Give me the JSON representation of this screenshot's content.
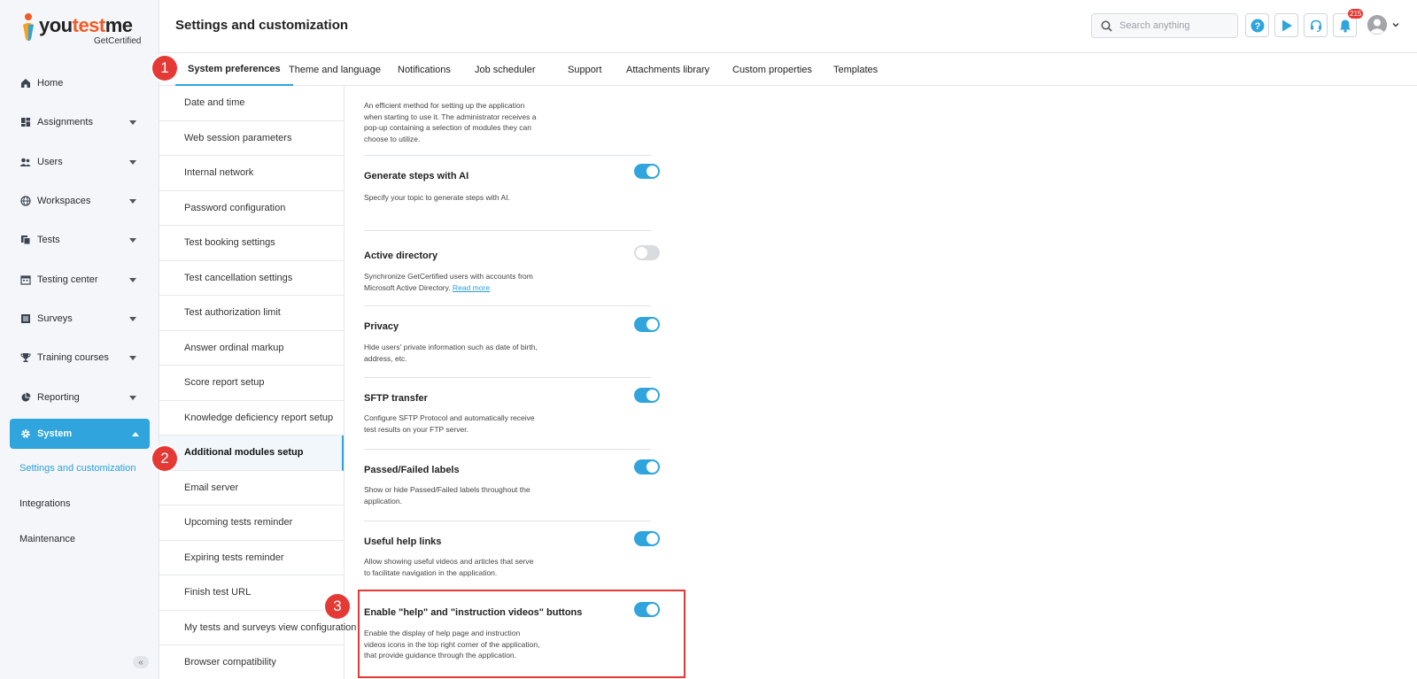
{
  "logo": {
    "brand_prefix": "you",
    "brand_accent": "test",
    "brand_suffix": "me",
    "sub": "GetCertified"
  },
  "sidebar": {
    "items": [
      {
        "label": "Home",
        "icon": "home-icon"
      },
      {
        "label": "Assignments",
        "icon": "dashboard-icon"
      },
      {
        "label": "Users",
        "icon": "users-icon"
      },
      {
        "label": "Workspaces",
        "icon": "globe-icon"
      },
      {
        "label": "Tests",
        "icon": "tests-icon"
      },
      {
        "label": "Testing center",
        "icon": "calendar-icon"
      },
      {
        "label": "Surveys",
        "icon": "list-icon"
      },
      {
        "label": "Training courses",
        "icon": "trophy-icon"
      },
      {
        "label": "Reporting",
        "icon": "chart-pie-icon"
      },
      {
        "label": "System",
        "icon": "gear-icon"
      }
    ],
    "sub_items": [
      {
        "label": "Settings and customization"
      },
      {
        "label": "Integrations"
      },
      {
        "label": "Maintenance"
      }
    ],
    "collapse_glyph": "«"
  },
  "header": {
    "title": "Settings and customization",
    "search_placeholder": "Search anything",
    "notification_count": "215"
  },
  "tabs": [
    {
      "label": "System preferences"
    },
    {
      "label": "Theme and language"
    },
    {
      "label": "Notifications"
    },
    {
      "label": "Job scheduler"
    },
    {
      "label": "Support"
    },
    {
      "label": "Attachments library"
    },
    {
      "label": "Custom properties"
    },
    {
      "label": "Templates"
    }
  ],
  "settings_list": [
    "Date and time",
    "Web session parameters",
    "Internal network",
    "Password configuration",
    "Test booking settings",
    "Test cancellation settings",
    "Test authorization limit",
    "Answer ordinal markup",
    "Score report setup",
    "Knowledge deficiency report setup",
    "Additional modules setup",
    "Email server",
    "Upcoming tests reminder",
    "Expiring tests reminder",
    "Finish test URL",
    "My tests and surveys view configuration",
    "Browser compatibility"
  ],
  "detail": {
    "intro": "An efficient method for setting up the application when starting to use it. The administrator receives a pop-up containing a selection of modules they can choose to utilize.",
    "sections": [
      {
        "title": "Generate steps with AI",
        "desc": "Specify your topic to generate steps with AI.",
        "enabled": true
      },
      {
        "title": "Active directory",
        "desc": "Synchronize GetCertified users with accounts from Microsoft Active Directory.",
        "link": "Read more",
        "enabled": false
      },
      {
        "title": "Privacy",
        "desc": "Hide users' private information such as date of birth, address, etc.",
        "enabled": true
      },
      {
        "title": "SFTP transfer",
        "desc": "Configure SFTP Protocol and automatically receive test results on your FTP server.",
        "enabled": true
      },
      {
        "title": "Passed/Failed labels",
        "desc": "Show or hide Passed/Failed labels throughout the application.",
        "enabled": true
      },
      {
        "title": "Useful help links",
        "desc": "Allow showing useful videos and articles that serve to facilitate navigation in the application.",
        "enabled": true
      },
      {
        "title": "Enable \"help\" and \"instruction videos\" buttons",
        "desc": "Enable the display of help page and instruction videos icons in the top right corner of the application, that provide guidance through the application.",
        "enabled": true
      }
    ]
  },
  "markers": [
    "1",
    "2",
    "3"
  ],
  "colors": {
    "accent": "#2fa4dd",
    "marker": "#e53935",
    "brand_orange": "#f15a24"
  }
}
